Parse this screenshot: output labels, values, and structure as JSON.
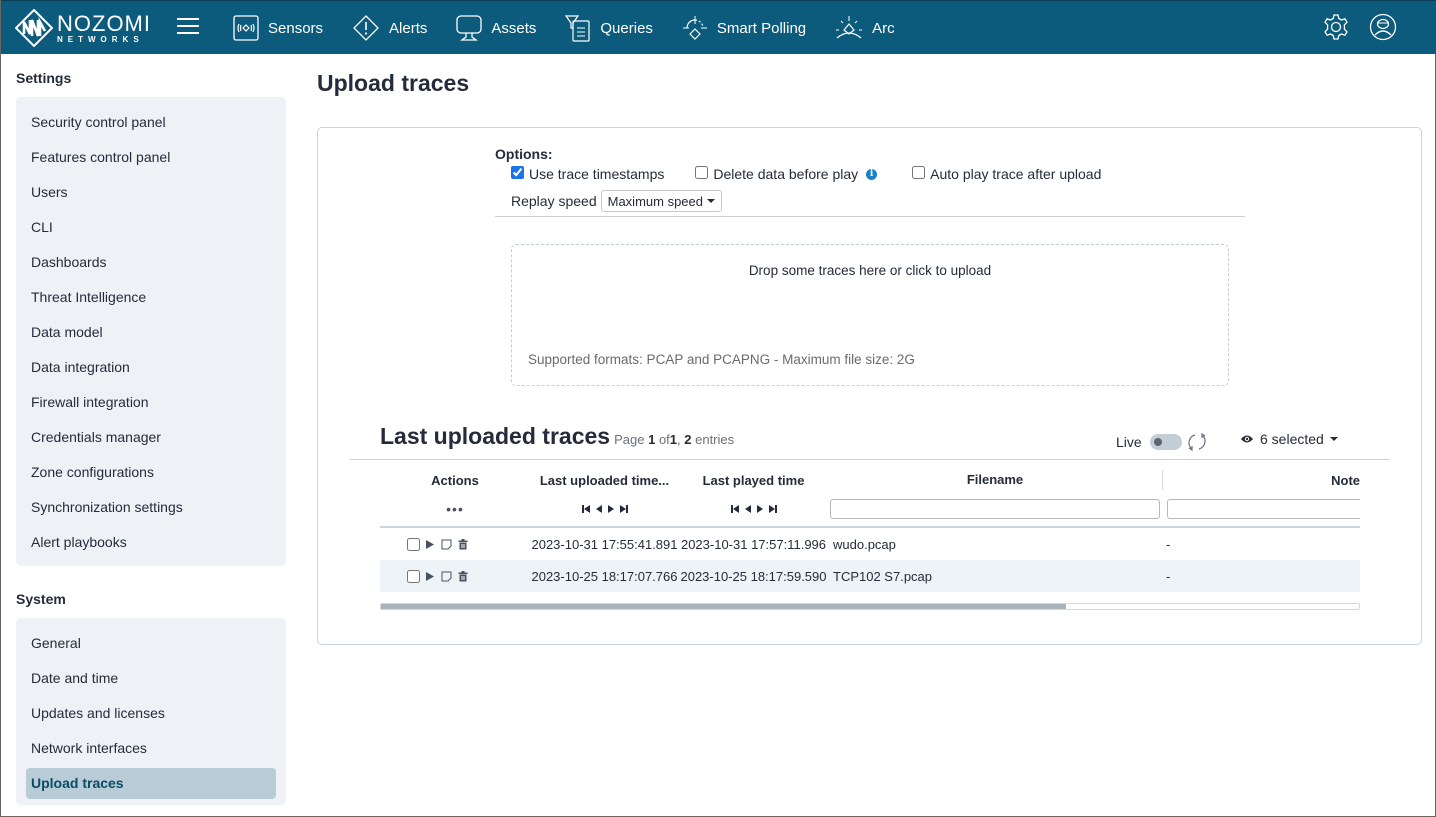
{
  "brand": {
    "name": "NOZOMI",
    "sub": "NETWORKS"
  },
  "nav": {
    "items": [
      {
        "label": "Sensors",
        "icon": "sensors-icon"
      },
      {
        "label": "Alerts",
        "icon": "alert-icon"
      },
      {
        "label": "Assets",
        "icon": "monitor-icon"
      },
      {
        "label": "Queries",
        "icon": "query-filter-icon"
      },
      {
        "label": "Smart Polling",
        "icon": "smart-polling-icon"
      },
      {
        "label": "Arc",
        "icon": "arc-icon"
      }
    ],
    "right_icons": [
      "gear-icon",
      "user-icon"
    ]
  },
  "sidebar": {
    "settings_title": "Settings",
    "settings_items": [
      "Security control panel",
      "Features control panel",
      "Users",
      "CLI",
      "Dashboards",
      "Threat Intelligence",
      "Data model",
      "Data integration",
      "Firewall integration",
      "Credentials manager",
      "Zone configurations",
      "Synchronization settings",
      "Alert playbooks"
    ],
    "system_title": "System",
    "system_items": [
      "General",
      "Date and time",
      "Updates and licenses",
      "Network interfaces",
      "Upload traces"
    ],
    "active_item": "Upload traces"
  },
  "page": {
    "title": "Upload traces",
    "options": {
      "title": "Options:",
      "use_timestamps": {
        "label": "Use trace timestamps",
        "checked": true
      },
      "delete_before_play": {
        "label": "Delete data before play",
        "checked": false,
        "info": "i"
      },
      "auto_play": {
        "label": "Auto play trace after upload",
        "checked": false
      },
      "replay_speed_label": "Replay speed",
      "replay_speed_value": "Maximum speed"
    },
    "dropzone": {
      "main": "Drop some traces here or click to upload",
      "sub": "Supported formats: PCAP and PCAPNG - Maximum file size: 2G"
    },
    "traces": {
      "title": "Last uploaded traces",
      "page_word": "Page",
      "page": "1",
      "of_word": "of",
      "pages": "1",
      "entries": "2",
      "entries_word": "entries",
      "live_label": "Live",
      "live_on": false,
      "columns_selected": "6 selected",
      "columns": [
        "Actions",
        "Last uploaded time...",
        "Last played time",
        "Filename",
        "Note"
      ],
      "actions_more": "•••",
      "filter_filename": "",
      "filter_note": "",
      "rows": [
        {
          "uploaded": "2023-10-31 17:55:41.891",
          "played": "2023-10-31 17:57:11.996",
          "filename": "wudo.pcap",
          "note": "-"
        },
        {
          "uploaded": "2023-10-25 18:17:07.766",
          "played": "2023-10-25 18:17:59.590",
          "filename": "TCP102 S7.pcap",
          "note": "-"
        }
      ],
      "hscroll_fraction": 0.7
    }
  }
}
